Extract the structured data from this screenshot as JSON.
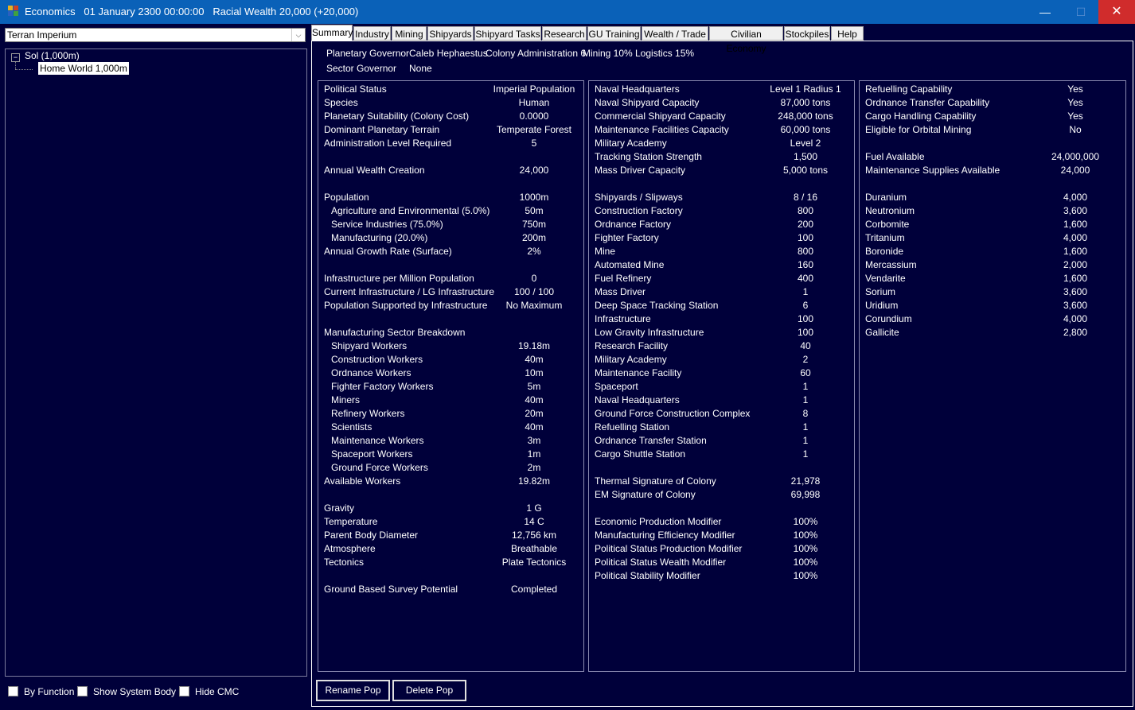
{
  "window": {
    "title": "Economics   01 January 2300 00:00:00   Racial Wealth 20,000 (+20,000)",
    "minimize": "—",
    "maximize": "☐",
    "close": "✕"
  },
  "left": {
    "empire": "Terran Imperium",
    "tree": {
      "system": "Sol  (1,000m)",
      "body": "Home World  1,000m"
    },
    "checkboxes": [
      "By Function",
      "Show System Body",
      "Hide CMC"
    ]
  },
  "tabs": [
    "Summary",
    "Industry",
    "Mining",
    "Shipyards",
    "Shipyard Tasks",
    "Research",
    "GU Training",
    "Wealth / Trade",
    "Civilian Economy",
    "Stockpiles",
    "Help"
  ],
  "governors": {
    "planetary_label": "Planetary Governor",
    "planetary_name": "Caleb Hephaestus",
    "bonus1": "Colony Administration 6",
    "bonus2": "Mining 10%",
    "bonus3": "Logistics 15%",
    "sector_label": "Sector Governor",
    "sector_name": "None"
  },
  "col1": [
    {
      "label": "Political Status",
      "value": "Imperial Population",
      "indent": false
    },
    {
      "label": "Species",
      "value": "Human",
      "indent": false
    },
    {
      "label": "Planetary Suitability (Colony Cost)",
      "value": "0.0000",
      "indent": false
    },
    {
      "label": "Dominant Planetary Terrain",
      "value": "Temperate Forest",
      "indent": false
    },
    {
      "label": "Administration Level Required",
      "value": "5",
      "indent": false
    },
    {
      "label": "",
      "value": "",
      "indent": false
    },
    {
      "label": "Annual Wealth Creation",
      "value": "24,000",
      "indent": false
    },
    {
      "label": "",
      "value": "",
      "indent": false
    },
    {
      "label": "Population",
      "value": "1000m",
      "indent": false
    },
    {
      "label": "Agriculture and Environmental (5.0%)",
      "value": "50m",
      "indent": true
    },
    {
      "label": "Service Industries (75.0%)",
      "value": "750m",
      "indent": true
    },
    {
      "label": "Manufacturing (20.0%)",
      "value": "200m",
      "indent": true
    },
    {
      "label": "Annual Growth Rate (Surface)",
      "value": "2%",
      "indent": false
    },
    {
      "label": "",
      "value": "",
      "indent": false
    },
    {
      "label": "Infrastructure per Million Population",
      "value": "0",
      "indent": false
    },
    {
      "label": "Current Infrastructure / LG Infrastructure",
      "value": "100 / 100",
      "indent": false
    },
    {
      "label": "Population Supported by Infrastructure",
      "value": "No Maximum",
      "indent": false
    },
    {
      "label": "",
      "value": "",
      "indent": false
    },
    {
      "label": "Manufacturing Sector Breakdown",
      "value": "",
      "indent": false
    },
    {
      "label": "Shipyard Workers",
      "value": "19.18m",
      "indent": true
    },
    {
      "label": "Construction Workers",
      "value": "40m",
      "indent": true
    },
    {
      "label": "Ordnance Workers",
      "value": "10m",
      "indent": true
    },
    {
      "label": "Fighter Factory Workers",
      "value": "5m",
      "indent": true
    },
    {
      "label": "Miners",
      "value": "40m",
      "indent": true
    },
    {
      "label": "Refinery Workers",
      "value": "20m",
      "indent": true
    },
    {
      "label": "Scientists",
      "value": "40m",
      "indent": true
    },
    {
      "label": "Maintenance Workers",
      "value": "3m",
      "indent": true
    },
    {
      "label": "Spaceport Workers",
      "value": "1m",
      "indent": true
    },
    {
      "label": "Ground Force Workers",
      "value": "2m",
      "indent": true
    },
    {
      "label": "Available Workers",
      "value": "19.82m",
      "indent": false
    },
    {
      "label": "",
      "value": "",
      "indent": false
    },
    {
      "label": "Gravity",
      "value": "1 G",
      "indent": false
    },
    {
      "label": "Temperature",
      "value": "14 C",
      "indent": false
    },
    {
      "label": "Parent Body Diameter",
      "value": "12,756 km",
      "indent": false
    },
    {
      "label": "Atmosphere",
      "value": "Breathable",
      "indent": false
    },
    {
      "label": "Tectonics",
      "value": "Plate Tectonics",
      "indent": false
    },
    {
      "label": "",
      "value": "",
      "indent": false
    },
    {
      "label": "Ground Based Survey Potential",
      "value": "Completed",
      "indent": false
    }
  ],
  "col2": [
    {
      "label": "Naval Headquarters",
      "value": "Level 1  Radius 1"
    },
    {
      "label": "Naval Shipyard Capacity",
      "value": "87,000 tons"
    },
    {
      "label": "Commercial Shipyard Capacity",
      "value": "248,000 tons"
    },
    {
      "label": "Maintenance Facilities Capacity",
      "value": "60,000 tons"
    },
    {
      "label": "Military Academy",
      "value": "Level 2"
    },
    {
      "label": "Tracking Station Strength",
      "value": "1,500"
    },
    {
      "label": "Mass Driver Capacity",
      "value": "5,000 tons"
    },
    {
      "label": "",
      "value": ""
    },
    {
      "label": "Shipyards / Slipways",
      "value": "8 / 16"
    },
    {
      "label": "Construction Factory",
      "value": "800"
    },
    {
      "label": "Ordnance Factory",
      "value": "200"
    },
    {
      "label": "Fighter Factory",
      "value": "100"
    },
    {
      "label": "Mine",
      "value": "800"
    },
    {
      "label": "Automated Mine",
      "value": "160"
    },
    {
      "label": "Fuel Refinery",
      "value": "400"
    },
    {
      "label": "Mass Driver",
      "value": "1"
    },
    {
      "label": "Deep Space Tracking Station",
      "value": "6"
    },
    {
      "label": "Infrastructure",
      "value": "100"
    },
    {
      "label": "Low Gravity Infrastructure",
      "value": "100"
    },
    {
      "label": "Research Facility",
      "value": "40"
    },
    {
      "label": "Military Academy",
      "value": "2"
    },
    {
      "label": "Maintenance Facility",
      "value": "60"
    },
    {
      "label": "Spaceport",
      "value": "1"
    },
    {
      "label": "Naval Headquarters",
      "value": "1"
    },
    {
      "label": "Ground Force Construction Complex",
      "value": "8"
    },
    {
      "label": "Refuelling Station",
      "value": "1"
    },
    {
      "label": "Ordnance Transfer Station",
      "value": "1"
    },
    {
      "label": "Cargo Shuttle Station",
      "value": "1"
    },
    {
      "label": "",
      "value": ""
    },
    {
      "label": "Thermal Signature of Colony",
      "value": "21,978"
    },
    {
      "label": "EM Signature of Colony",
      "value": "69,998"
    },
    {
      "label": "",
      "value": ""
    },
    {
      "label": "Economic Production Modifier",
      "value": "100%"
    },
    {
      "label": "Manufacturing Efficiency Modifier",
      "value": "100%"
    },
    {
      "label": "Political Status Production Modifier",
      "value": "100%"
    },
    {
      "label": "Political Status Wealth Modifier",
      "value": "100%"
    },
    {
      "label": "Political Stability Modifier",
      "value": "100%"
    }
  ],
  "col3": [
    {
      "label": "Refuelling Capability",
      "value": "Yes"
    },
    {
      "label": "Ordnance Transfer Capability",
      "value": "Yes"
    },
    {
      "label": "Cargo Handling Capability",
      "value": "Yes"
    },
    {
      "label": "Eligible for Orbital Mining",
      "value": "No"
    },
    {
      "label": "",
      "value": ""
    },
    {
      "label": "Fuel Available",
      "value": "24,000,000"
    },
    {
      "label": "Maintenance Supplies Available",
      "value": "24,000"
    },
    {
      "label": "",
      "value": ""
    },
    {
      "label": "Duranium",
      "value": "4,000"
    },
    {
      "label": "Neutronium",
      "value": "3,600"
    },
    {
      "label": "Corbomite",
      "value": "1,600"
    },
    {
      "label": "Tritanium",
      "value": "4,000"
    },
    {
      "label": "Boronide",
      "value": "1,600"
    },
    {
      "label": "Mercassium",
      "value": "2,000"
    },
    {
      "label": "Vendarite",
      "value": "1,600"
    },
    {
      "label": "Sorium",
      "value": "3,600"
    },
    {
      "label": "Uridium",
      "value": "3,600"
    },
    {
      "label": "Corundium",
      "value": "4,000"
    },
    {
      "label": "Gallicite",
      "value": "2,800"
    }
  ],
  "buttons": {
    "rename": "Rename Pop",
    "delete": "Delete Pop"
  }
}
